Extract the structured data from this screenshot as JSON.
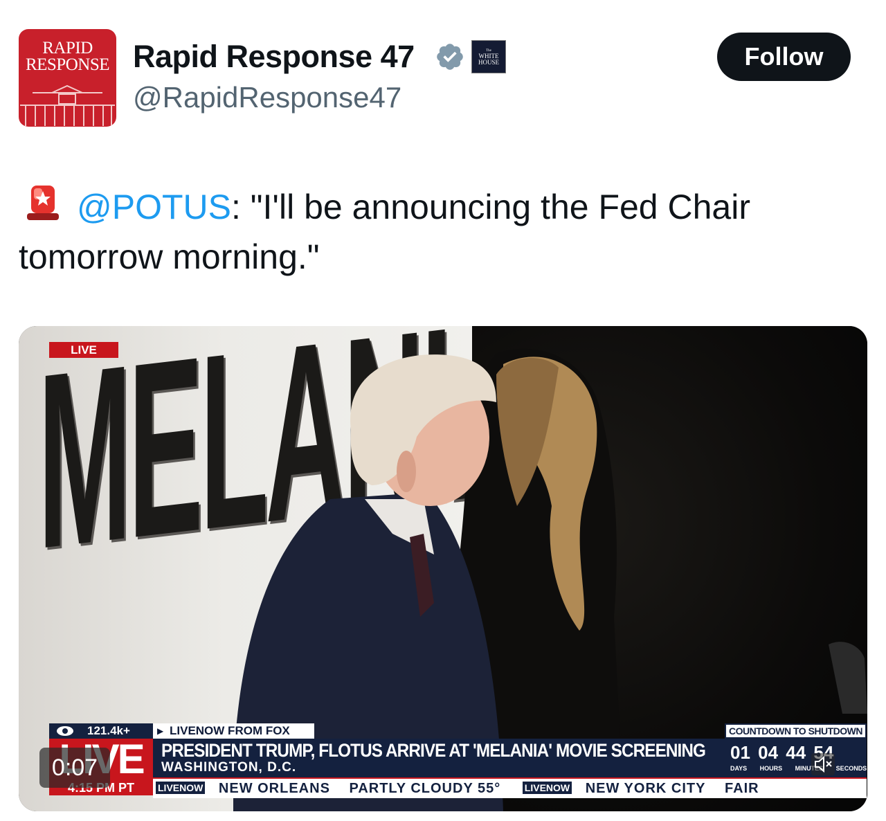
{
  "author": {
    "avatar_line1": "RAPID",
    "avatar_line2": "RESPONSE",
    "display_name": "Rapid Response 47",
    "handle": "@RapidResponse47",
    "verified_icon": "verified-badge-icon",
    "affiliation_badge_line1": "The",
    "affiliation_badge_line2": "WHITE",
    "affiliation_badge_line3": "HOUSE"
  },
  "follow_button": {
    "label": "Follow"
  },
  "tweet": {
    "siren_icon": "police-light-icon",
    "mention": "@POTUS",
    "text": ": \"I'll be announcing the Fed Chair tomorrow morning.\""
  },
  "video": {
    "elapsed": "0:07",
    "backdrop_word": "MELANIA",
    "live_tag": "LIVE",
    "viewers": "121.4k+",
    "source": "LIVENOW FROM FOX",
    "live_big": "LIVE",
    "headline": "PRESIDENT TRUMP, FLOTUS ARRIVE AT 'MELANIA' MOVIE SCREENING",
    "location": "WASHINGTON, D.C.",
    "local_time": "4:15 PM PT",
    "countdown_title": "COUNTDOWN TO SHUTDOWN",
    "countdown_values": "01 04 44 54",
    "countdown_units": "DAYS HOURS MINUTES SECONDS",
    "ticker_logo": "LIVENOW",
    "ticker_items": [
      "NEW ORLEANS",
      "PARTLY CLOUDY 55°",
      "NEW YORK CITY",
      "FAIR"
    ],
    "colors": {
      "chyron_navy": "#14213f",
      "chyron_red": "#c8161d"
    }
  }
}
